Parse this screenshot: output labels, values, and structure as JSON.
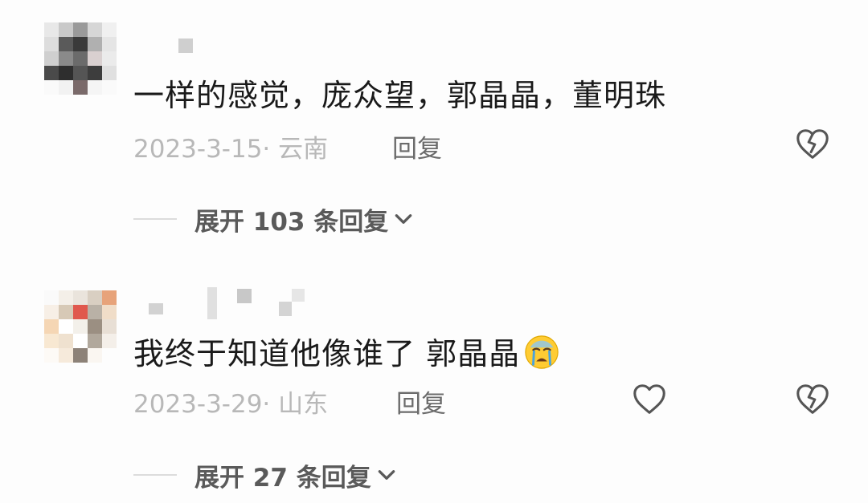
{
  "comments": [
    {
      "text": "一样的感觉，庞众望，郭晶晶，董明珠",
      "date_location": "2023-3-15· 云南",
      "reply_label": "回复",
      "expand_label": "展开 103 条回复",
      "icons": [
        "avatar",
        "dislike-heart-icon",
        "chevron-down-icon"
      ]
    },
    {
      "text": "我终于知道他像谁了 郭晶晶",
      "emoji": "crying-face-emoji",
      "date_location": "2023-3-29· 山东",
      "reply_label": "回复",
      "expand_label": "展开 27 条回复",
      "icons": [
        "avatar",
        "like-heart-icon",
        "dislike-heart-icon",
        "chevron-down-icon"
      ]
    }
  ],
  "colors": {
    "background": "#fdfdfd",
    "comment_text": "#1a1a1a",
    "meta_text": "#b8b8b8",
    "reply_text": "#6b6b6b",
    "expand_text": "#5a5a5a",
    "icon_stroke": "#555555"
  }
}
